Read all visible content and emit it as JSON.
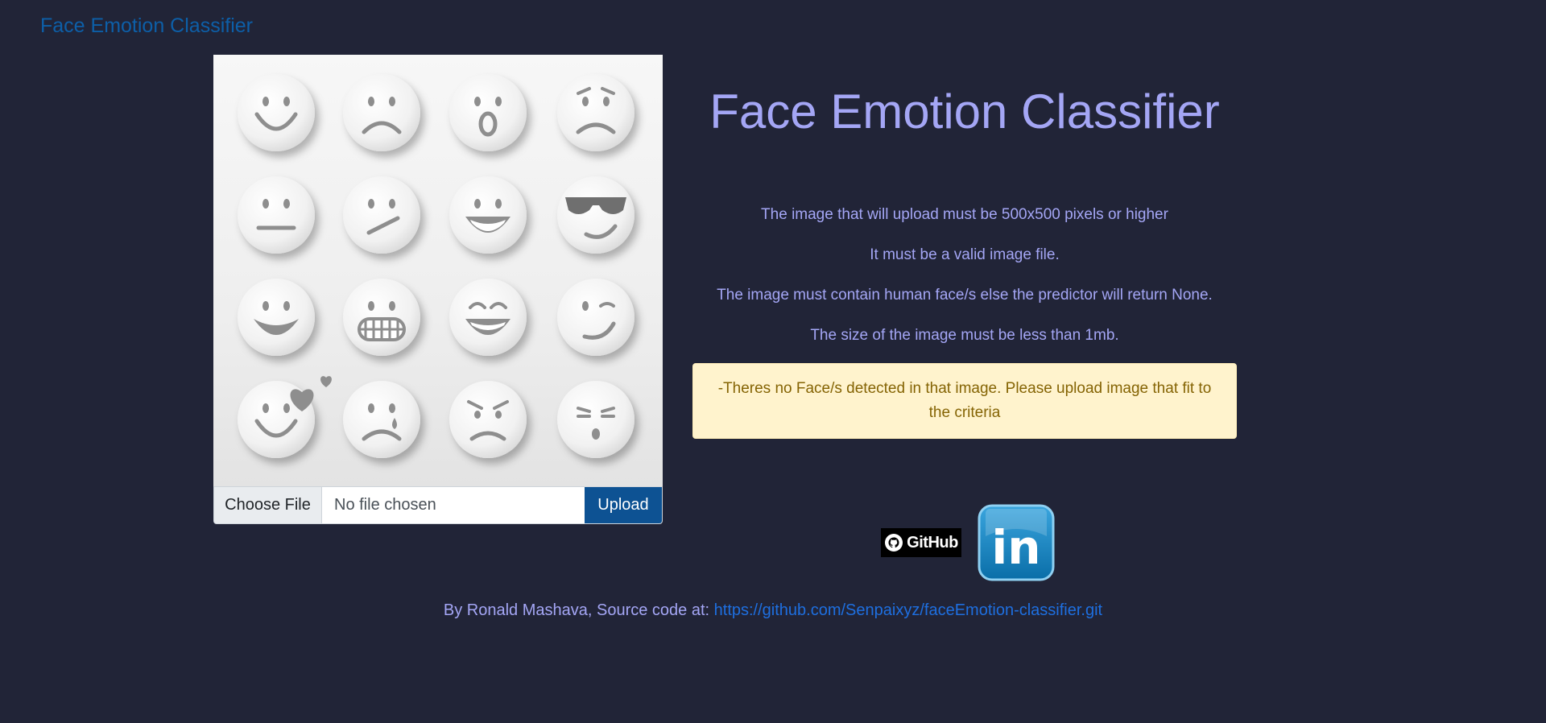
{
  "brand": "Face Emotion Classifier",
  "upload_form": {
    "choose_label": "Choose File",
    "file_status": "No file chosen",
    "upload_label": "Upload"
  },
  "title": "Face Emotion Classifier",
  "rules": [
    "The image that will upload must be 500x500 pixels or higher",
    "It must be a valid image file.",
    "The image must contain human face/s else the predictor will return None.",
    "The size of the image must be less than 1mb."
  ],
  "alert": "-Theres no Face/s detected in that image. Please upload image that fit to the criteria",
  "socials": {
    "github_text": "GitHub",
    "linkedin_text": "in"
  },
  "footer": {
    "prefix": "By Ronald Mashava, Source code at: ",
    "link": "https://github.com/Senpaixyz/faceEmotion-classifier.git"
  },
  "colors": {
    "background": "#212437",
    "brand": "#0d5fa8",
    "text": "#a4a6f5",
    "upload_button": "#0d5293",
    "alert_bg": "#fff3cd",
    "alert_text": "#856404",
    "link": "#1e6fe0"
  }
}
